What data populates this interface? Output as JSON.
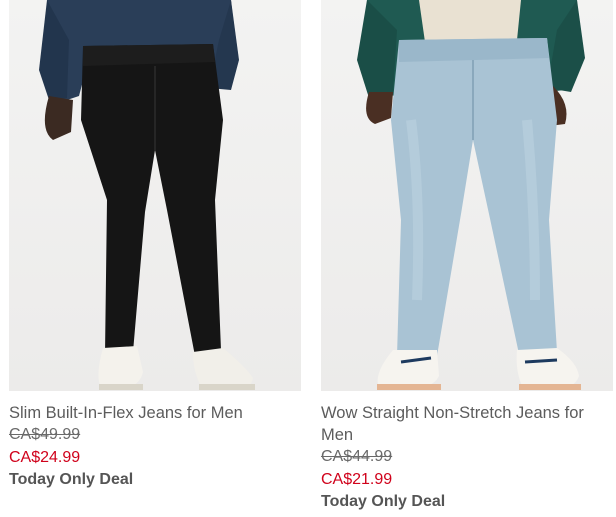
{
  "products": [
    {
      "name": "Slim Built-In-Flex Jeans for Men",
      "original_price": "CA$49.99",
      "sale_price": "CA$24.99",
      "promo": "Today Only Deal"
    },
    {
      "name": "Wow Straight Non-Stretch Jeans for Men",
      "original_price": "CA$44.99",
      "sale_price": "CA$21.99",
      "promo": "Today Only Deal"
    }
  ],
  "colors": {
    "sale_price": "#d0021b",
    "text": "#5c5c5c",
    "photo_bg": "#efefee"
  }
}
